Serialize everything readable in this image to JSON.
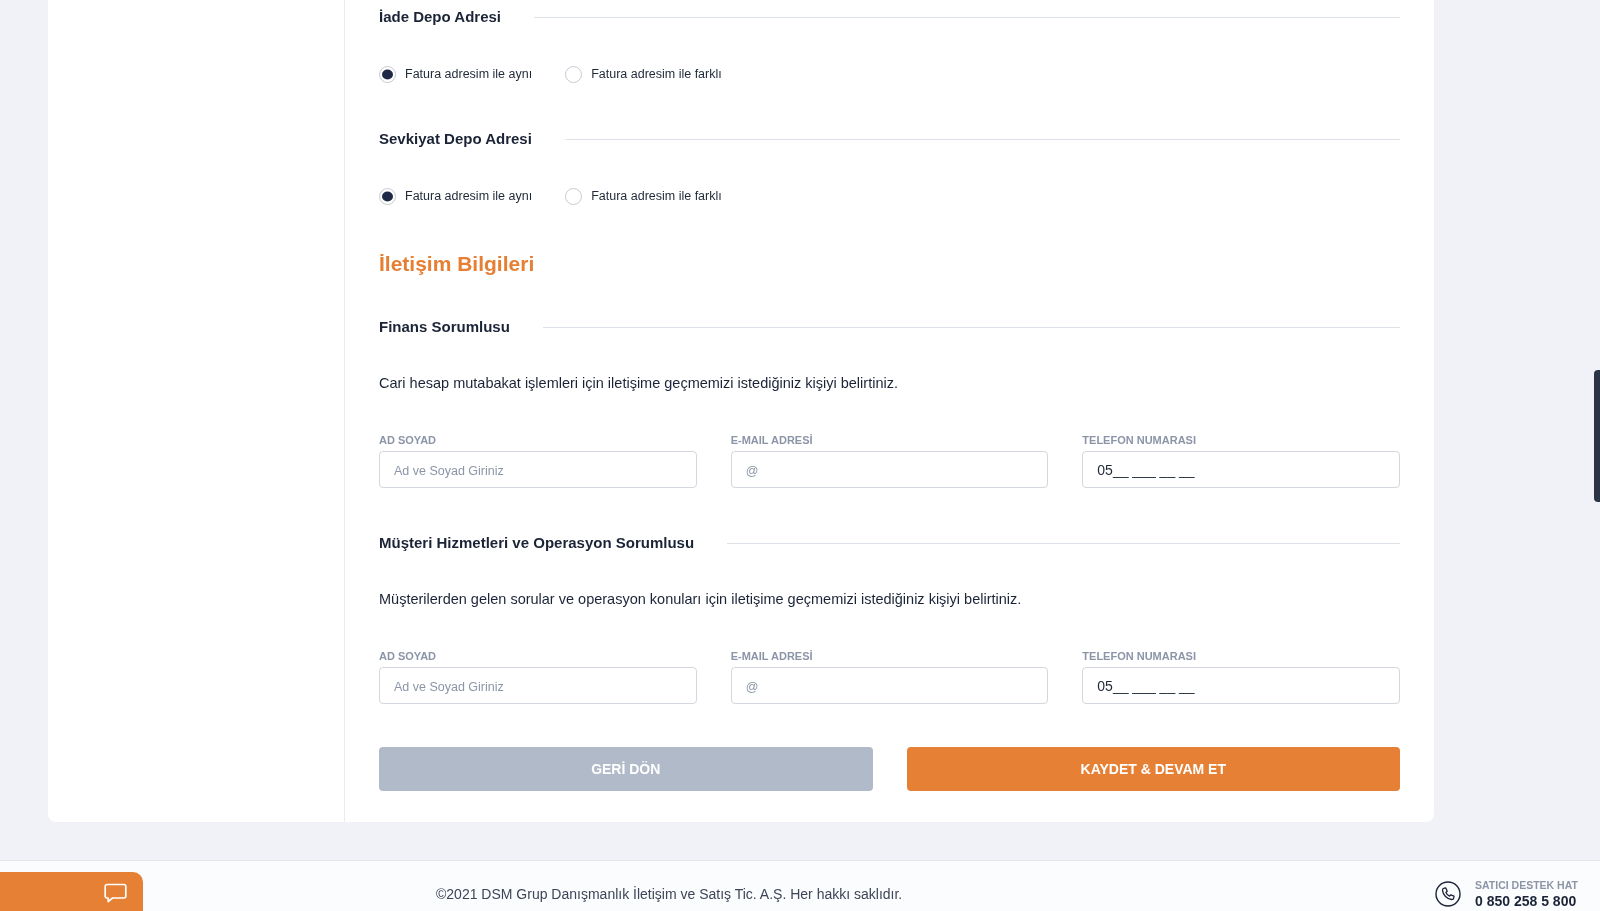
{
  "address_sections": [
    {
      "title": "İade Depo Adresi",
      "options": [
        {
          "label": "Fatura adresim ile aynı",
          "selected": true
        },
        {
          "label": "Fatura adresim ile farklı",
          "selected": false
        }
      ]
    },
    {
      "title": "Sevkiyat Depo Adresi",
      "options": [
        {
          "label": "Fatura adresim ile aynı",
          "selected": true
        },
        {
          "label": "Fatura adresim ile farklı",
          "selected": false
        }
      ]
    }
  ],
  "contact_section": {
    "title": "İletişim Bilgileri",
    "groups": [
      {
        "title": "Finans Sorumlusu",
        "description": "Cari hesap mutabakat işlemleri için iletişime geçmemizi istediğiniz kişiyi belirtiniz.",
        "fields": [
          {
            "label": "AD SOYAD",
            "placeholder": "Ad ve Soyad Giriniz"
          },
          {
            "label": "E-MAIL ADRESİ",
            "placeholder": "@"
          },
          {
            "label": "TELEFON NUMARASI",
            "value": "05__ ___ __ __"
          }
        ]
      },
      {
        "title": "Müşteri Hizmetleri ve Operasyon Sorumlusu",
        "description": "Müşterilerden gelen sorular ve operasyon konuları için iletişime geçmemizi istediğiniz kişiyi belirtiniz.",
        "fields": [
          {
            "label": "AD SOYAD",
            "placeholder": "Ad ve Soyad Giriniz"
          },
          {
            "label": "E-MAIL ADRESİ",
            "placeholder": "@"
          },
          {
            "label": "TELEFON NUMARASI",
            "value": "05__ ___ __ __"
          }
        ]
      }
    ]
  },
  "buttons": [
    {
      "label": "GERİ DÖN",
      "kind": "secondary"
    },
    {
      "label": "KAYDET & DEVAM ET",
      "kind": "primary"
    }
  ],
  "footer": {
    "copyright": "©2021 DSM Grup Danışmanlık İletişim ve Satış Tic. A.Ş. Her hakkı saklıdır.",
    "support_label": "SATICI DESTEK HAT",
    "support_phone": "0 850 258 5 800"
  }
}
